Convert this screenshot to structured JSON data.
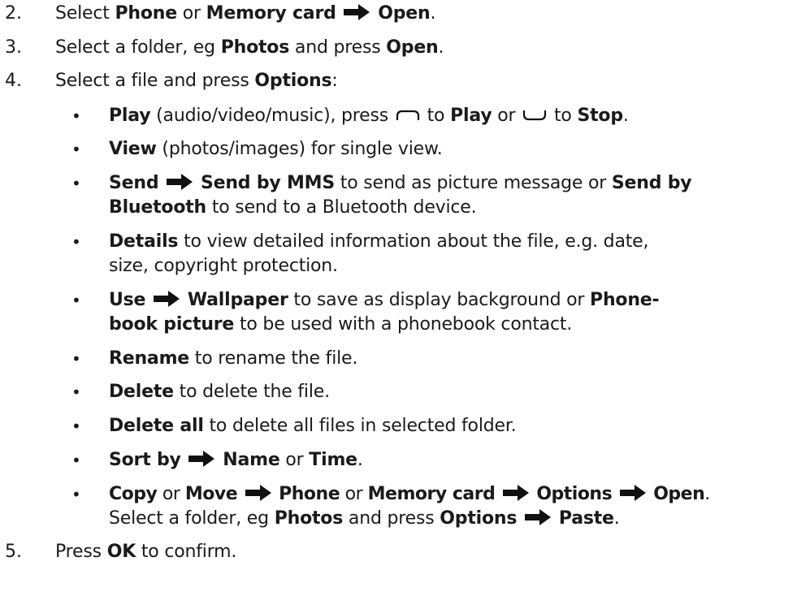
{
  "steps": [
    {
      "num": "2.",
      "parts": [
        "Select ",
        "Phone",
        " or ",
        "Memory card",
        "Open",
        "."
      ]
    },
    {
      "num": "3.",
      "parts": [
        "Select a folder, eg ",
        "Photos",
        " and press ",
        "Open",
        "."
      ]
    },
    {
      "num": "4.",
      "parts": [
        "Select a file and press ",
        "Options",
        ":"
      ]
    },
    {
      "num": "5.",
      "parts": [
        "Press ",
        "OK",
        " to confirm."
      ]
    }
  ],
  "bullets": {
    "symbol": "•",
    "play": {
      "b1": "Play",
      "t1": " (audio/video/music), press ",
      "t2": " to ",
      "b2": "Play",
      "t3": " or ",
      "t4": " to ",
      "b3": "Stop",
      "t5": "."
    },
    "view": {
      "b1": "View",
      "t1": " (photos/images) for single view."
    },
    "send": {
      "b1": "Send",
      "b2": "Send by MMS",
      "t1": " to send as picture message or ",
      "b3": "Send by",
      "b4": "Bluetooth",
      "t2": " to send to a Bluetooth device."
    },
    "details": {
      "b1": "Details",
      "t1": " to view detailed information about the file, e.g. date,",
      "t2": "size, copyright protection."
    },
    "use": {
      "b1": "Use",
      "b2": "Wallpaper",
      "t1": " to save as display background or ",
      "b3": "Phone-",
      "b4": "book picture",
      "t2": " to be used with a phonebook contact."
    },
    "rename": {
      "b1": "Rename",
      "t1": " to rename the file."
    },
    "delete": {
      "b1": "Delete",
      "t1": " to delete the file."
    },
    "delete_all": {
      "b1": "Delete all",
      "t1": " to delete all files in selected folder."
    },
    "sort": {
      "b1": "Sort by",
      "b2": "Name",
      "t1": " or ",
      "b3": "Time",
      "t2": "."
    },
    "copy": {
      "b1": "Copy",
      "t1": " or ",
      "b2": "Move",
      "b3": "Phone",
      "t2": " or ",
      "b4": "Memory card",
      "b5": "Options",
      "b6": "Open",
      "t3": ".",
      "t4": "Select a folder, eg ",
      "b7": "Photos",
      "t5": " and press ",
      "b8": "Options",
      "b9": "Paste",
      "t6": "."
    }
  },
  "icons": {
    "arrow": "right-arrow-icon",
    "left_key": "left-softkey-icon",
    "right_key": "right-softkey-icon"
  }
}
